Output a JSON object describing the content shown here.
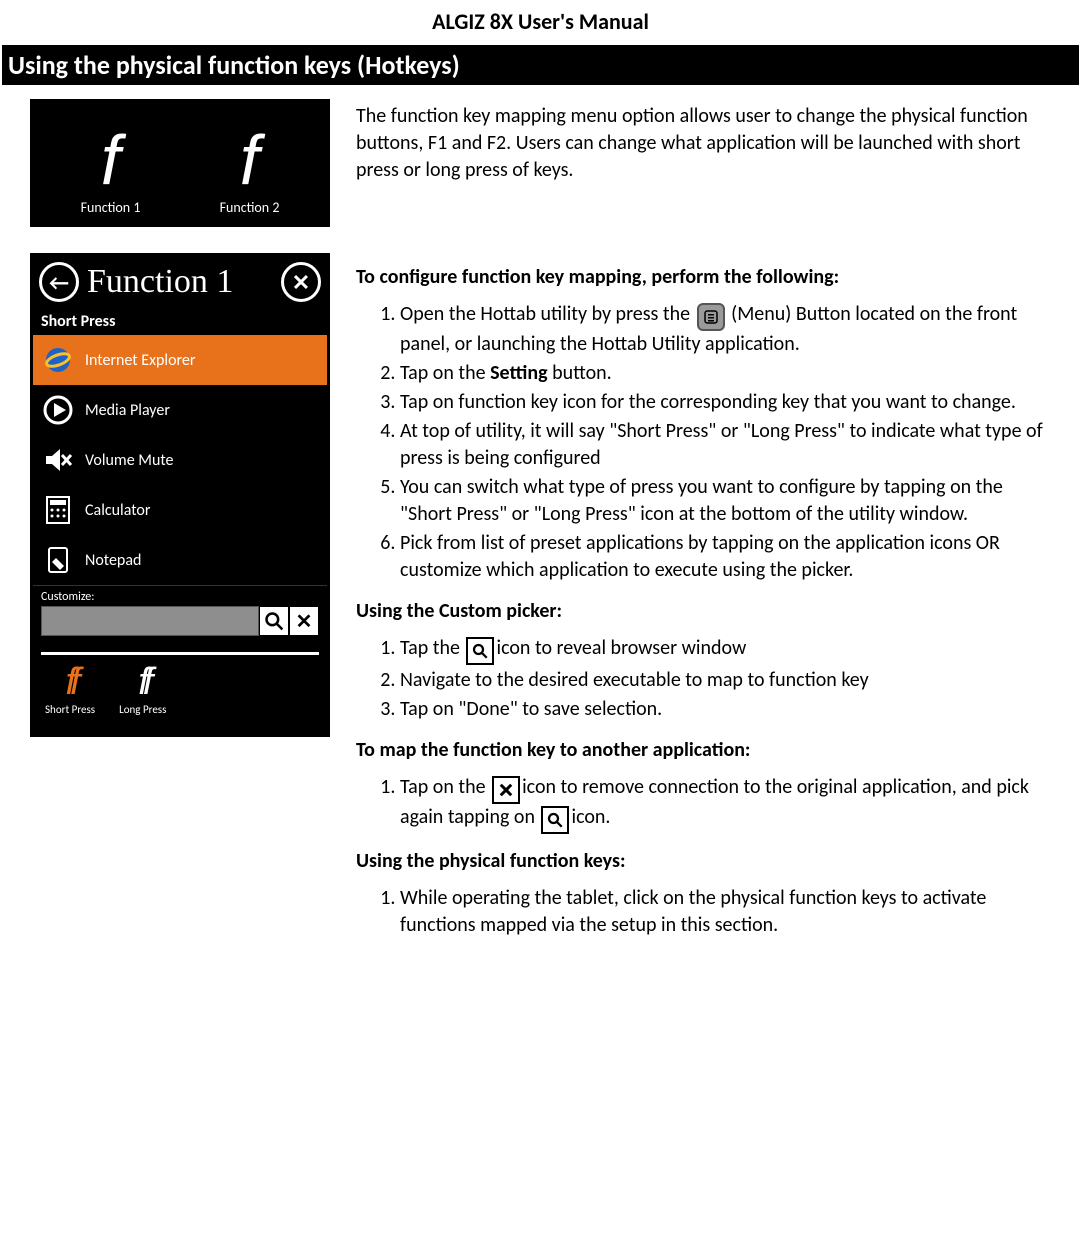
{
  "doc_title": "ALGIZ 8X User's Manual",
  "section_title": "Using the physical function keys (Hotkeys)",
  "shot1": {
    "f1_label": "Function 1",
    "f2_label": "Function 2"
  },
  "intro": "The function key mapping menu option allows user to change the physical function buttons, F1 and F2. Users can change what application will be launched with short press or long press of keys.",
  "shot2": {
    "title": "Function 1",
    "subhead": "Short Press",
    "apps": [
      {
        "name": "Internet Explorer",
        "selected": true
      },
      {
        "name": "Media Player",
        "selected": false
      },
      {
        "name": "Volume Mute",
        "selected": false
      },
      {
        "name": "Calculator",
        "selected": false
      },
      {
        "name": "Notepad",
        "selected": false
      }
    ],
    "customize_label": "Customize:",
    "short_press_label": "Short Press",
    "long_press_label": "Long Press"
  },
  "configure_head": "To configure function key mapping, perform the following:",
  "steps_main": {
    "s1a": "Open the Hottab utility by press the",
    "s1b": "(Menu) Button located on the front panel, or launching the Hottab Utility application.",
    "s2a": "Tap on the ",
    "s2b": "Setting",
    "s2c": " button.",
    "s3": "Tap on function key icon for the corresponding key that you want to change.",
    "s4": "At top of utility, it will say \"Short Press\" or \"Long Press\" to indicate what type of press is being configured",
    "s5": "You can switch what type of press you want to configure by tapping on the \"Short Press\" or \"Long Press\" icon at the bottom of the utility window.",
    "s6": "Pick from list of preset applications by tapping on the application icons OR customize which application to execute using the picker."
  },
  "custom_head": "Using the Custom picker:",
  "steps_custom": {
    "c1a": "Tap the ",
    "c1b": "icon to reveal browser window",
    "c2": "Navigate to the desired executable to map to function key",
    "c3": "Tap on \"Done\" to save selection."
  },
  "map_head": "To map the function key to another application:",
  "steps_map": {
    "m1a": " Tap on the ",
    "m1b": "icon to remove connection to the original application, and pick again tapping on ",
    "m1c": "icon."
  },
  "phys_head": "Using the physical function keys:",
  "steps_phys": {
    "p1": "While operating the tablet, click on the physical function keys to activate functions mapped via the setup in this section."
  }
}
